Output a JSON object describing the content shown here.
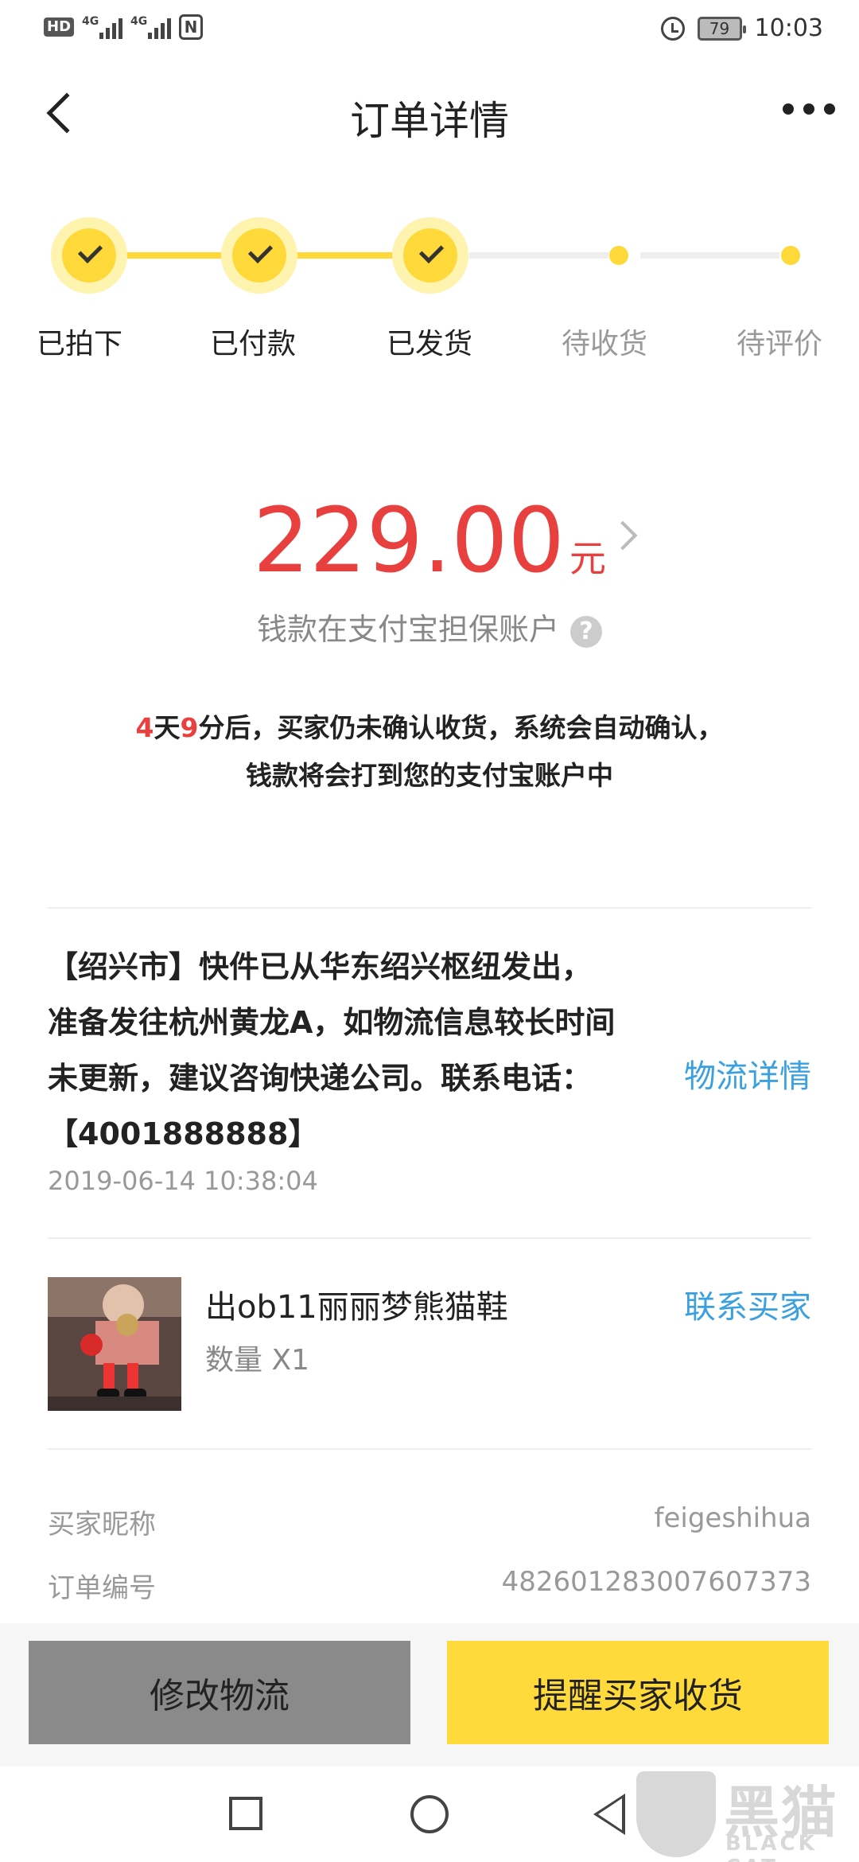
{
  "status_bar": {
    "network_1": "4G",
    "network_2": "4G",
    "battery": "79",
    "time": "10:03"
  },
  "header": {
    "title": "订单详情"
  },
  "progress": {
    "steps": [
      {
        "label": "已拍下",
        "done": true
      },
      {
        "label": "已付款",
        "done": true
      },
      {
        "label": "已发货",
        "done": true
      },
      {
        "label": "待收货",
        "done": false
      },
      {
        "label": "待评价",
        "done": false
      }
    ],
    "accent_color": "#ffd93a"
  },
  "amount": {
    "value": "229.00",
    "unit": "元",
    "escrow_text": "钱款在支付宝担保账户",
    "help_icon": "?"
  },
  "notice": {
    "days": "4",
    "days_unit": "天",
    "minutes": "9",
    "line1_rest": "分后，买家仍未确认收货，系统会自动确认，",
    "line2": "钱款将会打到您的支付宝账户中"
  },
  "logistics": {
    "lines": [
      "【绍兴市】快件已从华东绍兴枢纽发出，",
      "准备发往杭州黄龙A，如物流信息较长时间",
      "未更新，建议咨询快递公司。联系电话：",
      "【4001888888】"
    ],
    "time": "2019-06-14 10:38:04",
    "detail_link": "物流详情"
  },
  "product": {
    "name": "出ob11丽丽梦熊猫鞋",
    "quantity": "数量 X1",
    "contact_label": "联系买家"
  },
  "info": {
    "buyer_label": "买家昵称",
    "buyer_value": "feigeshihua",
    "order_label": "订单编号",
    "order_value": "4826012830076073​73"
  },
  "footer": {
    "modify_label": "修改物流",
    "remind_label": "提醒买家收货"
  },
  "watermark": {
    "text": "黑猫",
    "sub": "BLACK CAT"
  }
}
